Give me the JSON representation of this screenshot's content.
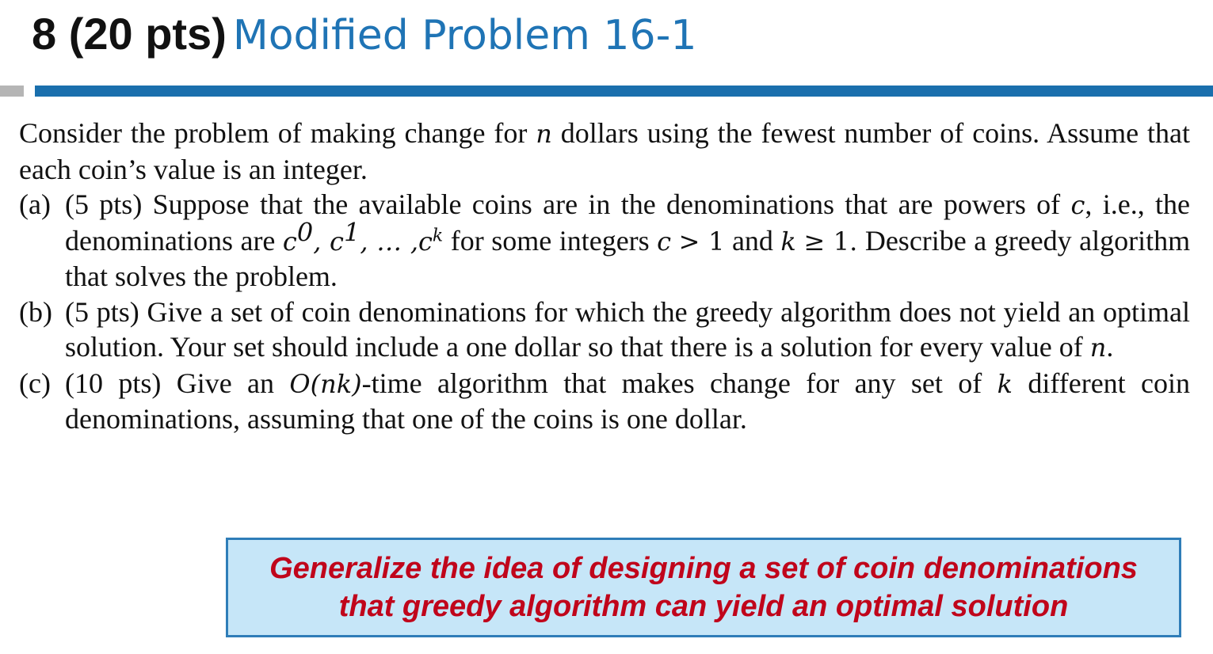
{
  "slide": {
    "title_pts": "8 (20 pts)",
    "title_name": "Modified Problem 16-1"
  },
  "problem": {
    "intro_a": "Consider the problem of making change for",
    "intro_b": "dollars using the fewest number of coins. Assume that each coin’s value is an integer.",
    "var_n": "n",
    "parts": [
      {
        "letter": "(a)",
        "t1": "(5 pts) Suppose that the available coins are in the denominations that are powers of",
        "c": "c",
        "t2": ", i.e., the denominations are",
        "seq_c0": "c",
        "sup0": "0",
        "seq_c1": "c",
        "sup1": "1",
        "seq_dots": ", … ,",
        "seq_ck": "c",
        "supk": "k",
        "t3": "for some integers",
        "cond1_var": "c",
        "cond1_rest": "> 1",
        "t4": "and",
        "cond2_var": "k",
        "cond2_rest": "≥ 1.",
        "t5": "Describe a greedy algorithm that solves the problem."
      },
      {
        "letter": "(b)",
        "t1": "(5 pts) Give a set of coin denominations for which the greedy algorithm does not yield an optimal solution. Your set should include a one dollar so that there is a solution for every value of",
        "n": "n",
        "t2": "."
      },
      {
        "letter": "(c)",
        "t1": "(10 pts) Give an",
        "O": "O",
        "onk": "(nk)",
        "t2": "-time algorithm that makes change for any set of",
        "k": "k",
        "t3": "different coin denominations, assuming that one of the coins is one dollar."
      }
    ]
  },
  "callout": {
    "line1": "Generalize the idea of designing a set of coin denominations",
    "line2": "that greedy algorithm can yield an optimal solution"
  },
  "colors": {
    "title_blue": "#1f74b5",
    "rule_blue": "#1a6fad",
    "callout_bg": "#c6e6f8",
    "callout_text": "#c0051b"
  }
}
